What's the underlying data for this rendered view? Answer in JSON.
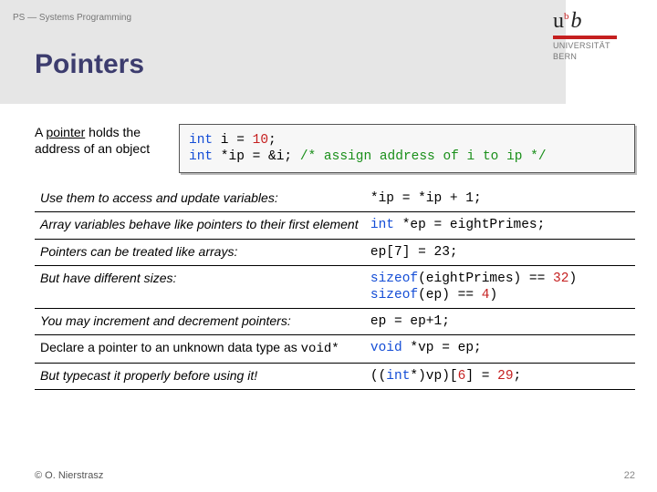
{
  "breadcrumb": "PS — Systems Programming",
  "title": "Pointers",
  "logo": {
    "ub": "u",
    "b": "b",
    "sub1": "UNIVERSITÄT",
    "sub2": "BERN"
  },
  "intro": {
    "pre": "A ",
    "keyword": "pointer",
    "post": " holds the address of an object",
    "code_html": "<span class='kw'>int</span> i = <span class='num'>10</span>;\n<span class='kw'>int</span> *ip = &i; <span class='cmt'>/* assign address of i to ip */</span>"
  },
  "rows": [
    {
      "label": "Use them to access and update variables:",
      "code": "*ip = *ip + 1;"
    },
    {
      "label": "Array variables behave like pointers to their first element",
      "code_html": "<span class='kw'>int</span> *ep = eightPrimes;"
    },
    {
      "label": "Pointers can be treated like arrays:",
      "code": "ep[7] = 23;"
    },
    {
      "label": "But have different sizes:",
      "code_html": "<span class='kw'>sizeof</span>(eightPrimes) == <span class='num'>32</span>)\n<span class='kw'>sizeof</span>(ep) == <span class='num'>4</span>)"
    },
    {
      "label": "You may increment and decrement pointers:",
      "code": "ep = ep+1;"
    },
    {
      "label_html": "Declare a pointer to an unknown data type as <span class='mono'>void*</span>",
      "code_html": "<span class='kw'>void</span> *vp = ep;"
    },
    {
      "label": "But typecast it properly before using it!",
      "code_html": "((<span class='kw'>int</span>*)vp)[<span class='num'>6</span>] = <span class='num'>29</span>;"
    }
  ],
  "footer": {
    "copyright": "© O. Nierstrasz",
    "page": "22"
  }
}
